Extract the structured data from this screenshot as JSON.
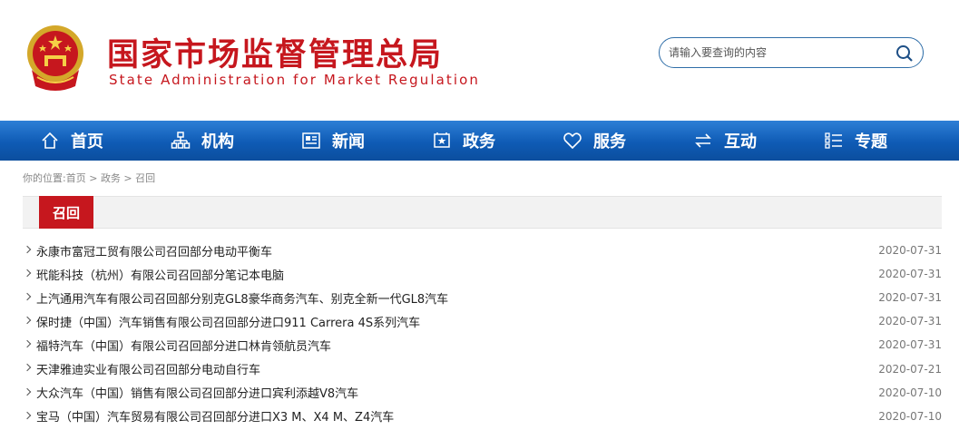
{
  "header": {
    "title": "国家市场监督管理总局",
    "subtitle": "State Administration for Market Regulation",
    "search_placeholder": "请输入要查询的内容"
  },
  "nav": {
    "items": [
      {
        "label": "首页",
        "icon": "home-icon"
      },
      {
        "label": "机构",
        "icon": "org-chart-icon"
      },
      {
        "label": "新闻",
        "icon": "newspaper-icon"
      },
      {
        "label": "政务",
        "icon": "government-icon"
      },
      {
        "label": "服务",
        "icon": "heart-icon"
      },
      {
        "label": "互动",
        "icon": "exchange-icon"
      },
      {
        "label": "专题",
        "icon": "topics-icon"
      }
    ]
  },
  "breadcrumb": {
    "prefix": "你的位置:",
    "home": "首页",
    "sep": " > ",
    "level1": "政务",
    "level2": "召回"
  },
  "section": {
    "title": "召回"
  },
  "recalls": [
    {
      "title": "永康市富冠工贸有限公司召回部分电动平衡车",
      "date": "2020-07-31"
    },
    {
      "title": "玳能科技（杭州）有限公司召回部分笔记本电脑",
      "date": "2020-07-31"
    },
    {
      "title": "上汽通用汽车有限公司召回部分别克GL8豪华商务汽车、别克全新一代GL8汽车",
      "date": "2020-07-31"
    },
    {
      "title": "保时捷（中国）汽车销售有限公司召回部分进口911 Carrera 4S系列汽车",
      "date": "2020-07-31"
    },
    {
      "title": "福特汽车（中国）有限公司召回部分进口林肯领航员汽车",
      "date": "2020-07-31"
    },
    {
      "title": "天津雅迪实业有限公司召回部分电动自行车",
      "date": "2020-07-21"
    },
    {
      "title": "大众汽车（中国）销售有限公司召回部分进口宾利添越V8汽车",
      "date": "2020-07-10"
    },
    {
      "title": "宝马（中国）汽车贸易有限公司召回部分进口X3 M、X4 M、Z4汽车",
      "date": "2020-07-10"
    }
  ],
  "colors": {
    "brand_red": "#c6171e",
    "nav_blue": "#0f5bb5"
  }
}
